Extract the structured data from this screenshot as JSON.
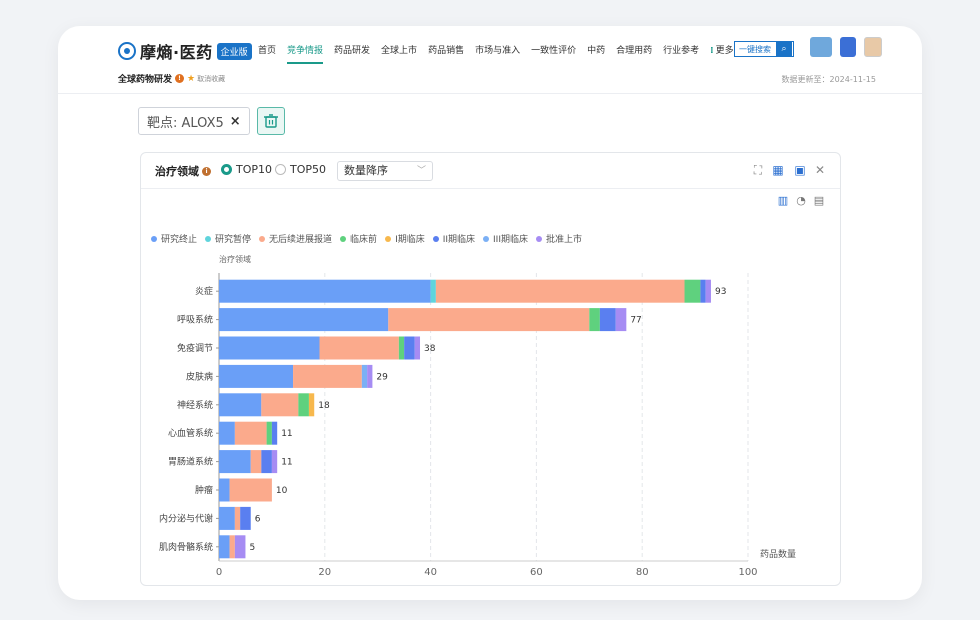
{
  "header": {
    "logo_text": "摩熵·医药",
    "logo_badge": "企业版",
    "nav": [
      "首页",
      "竞争情报",
      "药品研发",
      "全球上市",
      "药品销售",
      "市场与准入",
      "一致性评价",
      "中药",
      "合理用药",
      "行业参考"
    ],
    "nav_more": "更多",
    "active_nav": "竞争情报",
    "search_label": "一键搜索"
  },
  "breadcrumb": {
    "title": "全球药物研发",
    "info": "!",
    "favorite_label": "取消收藏"
  },
  "update_text": "数据更新至：2024-11-15",
  "filter": {
    "target_label": "靶点: ALOX5",
    "remove_icon": "×"
  },
  "panel": {
    "title": "治疗领域",
    "radios": [
      "TOP10",
      "TOP50"
    ],
    "selected_radio": "TOP10",
    "sort_value": "数量降序"
  },
  "colors": {
    "accent": "#1a9a8a",
    "brand": "#1a73c7"
  },
  "chart_data": {
    "type": "bar",
    "orientation": "horizontal",
    "stacked": true,
    "ylabel": "治疗领域",
    "xlabel": "药品数量",
    "xlim": [
      0,
      100
    ],
    "xticks": [
      0,
      20,
      40,
      60,
      80,
      100
    ],
    "grid": true,
    "legend_position": "top-left",
    "categories": [
      "炎症",
      "呼吸系统",
      "免疫调节",
      "皮肤病",
      "神经系统",
      "心血管系统",
      "胃肠道系统",
      "肿瘤",
      "内分泌与代谢",
      "肌肉骨骼系统"
    ],
    "totals": [
      93,
      77,
      38,
      29,
      18,
      11,
      11,
      10,
      6,
      5
    ],
    "series": [
      {
        "name": "研究终止",
        "color": "#6a9ff7",
        "values": [
          40,
          32,
          19,
          14,
          8,
          3,
          6,
          2,
          3,
          2
        ]
      },
      {
        "name": "研究暂停",
        "color": "#5fd4dc",
        "values": [
          1,
          0,
          0,
          0,
          0,
          0,
          0,
          0,
          0,
          0
        ]
      },
      {
        "name": "无后续进展报道",
        "color": "#fbaa8c",
        "values": [
          47,
          38,
          15,
          13,
          7,
          6,
          2,
          8,
          1,
          1
        ]
      },
      {
        "name": "临床前",
        "color": "#5fd17e",
        "values": [
          3,
          2,
          1,
          0,
          2,
          1,
          0,
          0,
          0,
          0
        ]
      },
      {
        "name": "I期临床",
        "color": "#f7b84d",
        "values": [
          0,
          0,
          0,
          0,
          1,
          0,
          0,
          0,
          0,
          0
        ]
      },
      {
        "name": "II期临床",
        "color": "#5a7ff0",
        "values": [
          1,
          3,
          2,
          0,
          0,
          1,
          2,
          0,
          2,
          0
        ]
      },
      {
        "name": "III期临床",
        "color": "#7bb0f5",
        "values": [
          0,
          0,
          0,
          1,
          0,
          0,
          0,
          0,
          0,
          0
        ]
      },
      {
        "name": "批准上市",
        "color": "#a68cf3",
        "values": [
          1,
          2,
          1,
          1,
          0,
          0,
          1,
          0,
          0,
          2
        ]
      }
    ]
  }
}
